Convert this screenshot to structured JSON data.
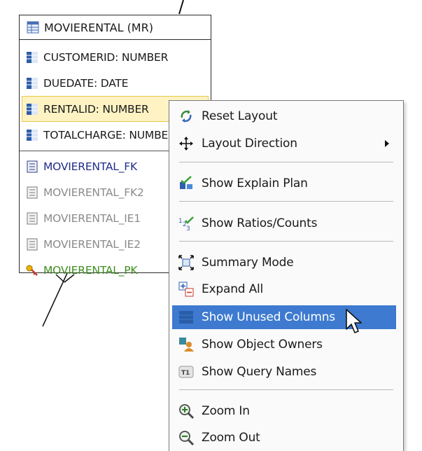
{
  "entity": {
    "title": "MOVIERENTAL (MR)",
    "columns": [
      {
        "label": "CUSTOMERID: NUMBER"
      },
      {
        "label": "DUEDATE: DATE"
      },
      {
        "label": "RENTALID: NUMBER"
      },
      {
        "label": "TOTALCHARGE: NUMBER"
      }
    ],
    "indexes": [
      {
        "label": "MOVIERENTAL_FK"
      },
      {
        "label": "MOVIERENTAL_FK2"
      },
      {
        "label": "MOVIERENTAL_IE1"
      },
      {
        "label": "MOVIERENTAL_IE2"
      },
      {
        "label": "MOVIERENTAL_PK"
      }
    ]
  },
  "context_menu": {
    "items": [
      {
        "label": "Reset Layout",
        "icon": "reset-layout-icon"
      },
      {
        "label": "Layout Direction",
        "icon": "layout-direction-icon",
        "submenu": true
      },
      {
        "label": "Show Explain Plan",
        "icon": "explain-plan-icon"
      },
      {
        "label": "Show Ratios/Counts",
        "icon": "ratios-counts-icon"
      },
      {
        "label": "Summary Mode",
        "icon": "summary-mode-icon"
      },
      {
        "label": "Expand All",
        "icon": "expand-all-icon"
      },
      {
        "label": "Show Unused Columns",
        "icon": "unused-columns-icon",
        "highlighted": true
      },
      {
        "label": "Show Object Owners",
        "icon": "object-owners-icon"
      },
      {
        "label": "Show Query Names",
        "icon": "query-names-icon"
      },
      {
        "label": "Zoom In",
        "icon": "zoom-in-icon"
      },
      {
        "label": "Zoom Out",
        "icon": "zoom-out-icon"
      }
    ]
  },
  "colors": {
    "highlight": "#3d7ad0",
    "selected_row": "#fff3c4",
    "fk_text": "#1f2c8a",
    "ie_text": "#8b8b8b",
    "pk_text": "#3f8f1e"
  }
}
